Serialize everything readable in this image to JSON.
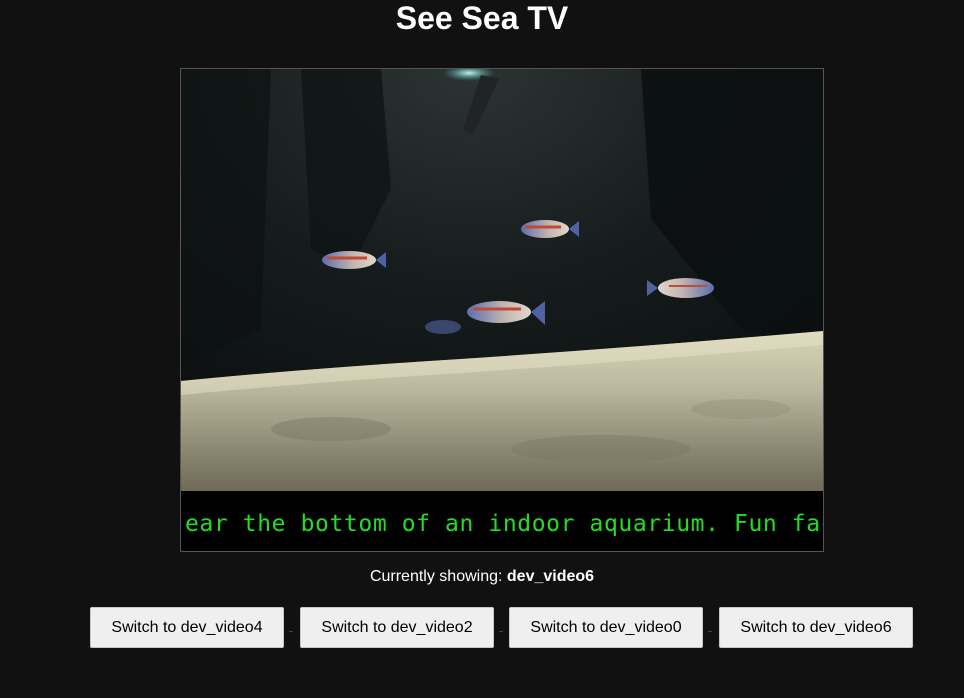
{
  "page": {
    "title": "See Sea TV"
  },
  "video": {
    "ticker_text": "ear the bottom of an indoor aquarium. Fun fact:",
    "ticker_color": "#22dd22"
  },
  "status": {
    "prefix": "Currently showing: ",
    "current": "dev_video6"
  },
  "buttons": [
    {
      "label": "Switch to dev_video4"
    },
    {
      "label": "Switch to dev_video2"
    },
    {
      "label": "Switch to dev_video0"
    },
    {
      "label": "Switch to dev_video6"
    }
  ]
}
